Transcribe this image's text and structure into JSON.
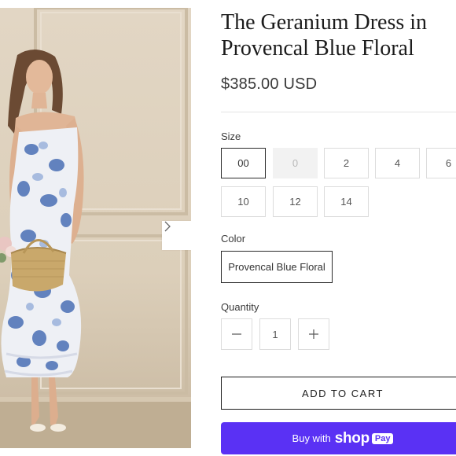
{
  "product": {
    "title_line1": "The Geranium Dress in",
    "title_line2": "Provencal Blue Floral",
    "price": "$385.00 USD"
  },
  "size": {
    "label": "Size",
    "options": [
      "00",
      "0",
      "2",
      "4",
      "6",
      "10",
      "12",
      "14"
    ],
    "selected": "00",
    "unavailable": [
      "0"
    ]
  },
  "color": {
    "label": "Color",
    "options": [
      "Provencal Blue Floral"
    ],
    "selected": "Provencal Blue Floral"
  },
  "quantity": {
    "label": "Quantity",
    "value": "1",
    "decrement_icon": "minus-icon",
    "increment_icon": "plus-icon"
  },
  "actions": {
    "add_to_cart": "ADD TO CART",
    "shop_pay_prefix": "Buy with",
    "shop_pay_brand": "shop",
    "shop_pay_badge": "Pay"
  },
  "gallery": {
    "next_icon": "chevron-right-icon"
  },
  "colors": {
    "shop_pay": "#5a31f4",
    "floral_blue": "#4a6fb5"
  }
}
